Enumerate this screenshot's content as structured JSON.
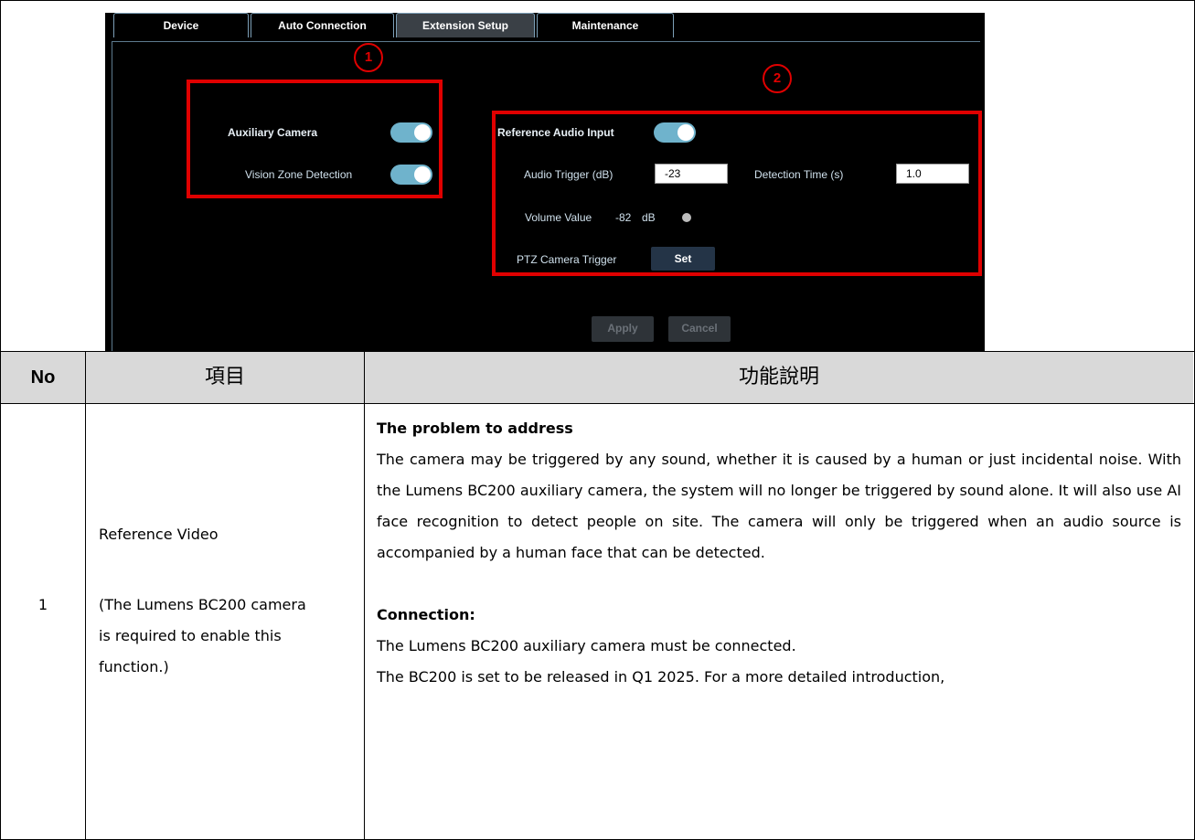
{
  "screenshot": {
    "tabs": [
      "Device",
      "Auto Connection",
      "Extension Setup",
      "Maintenance"
    ],
    "active_tab": "Extension Setup",
    "markers": [
      "1",
      "2"
    ],
    "left_panel": {
      "auxiliary_camera_label": "Auxiliary Camera",
      "auxiliary_camera_on": true,
      "vision_zone_label": "Vision Zone Detection",
      "vision_zone_on": true
    },
    "right_panel": {
      "reference_audio_label": "Reference Audio Input",
      "reference_audio_on": true,
      "audio_trigger_label": "Audio Trigger (dB)",
      "audio_trigger_value": "-23",
      "detection_time_label": "Detection Time (s)",
      "detection_time_value": "1.0",
      "volume_label": "Volume Value",
      "volume_value": "-82",
      "volume_unit": "dB",
      "ptz_label": "PTZ Camera Trigger",
      "set_label": "Set"
    },
    "apply_label": "Apply",
    "cancel_label": "Cancel"
  },
  "table": {
    "headers": [
      "No",
      "項目",
      "功能說明"
    ],
    "row": {
      "no": "1",
      "item_title": "Reference Video",
      "item_note": "(The Lumens BC200 camera is required to enable this function.)",
      "problem_heading": "The problem to address",
      "problem_text": "The camera may be triggered by any sound, whether it is caused by a human or just incidental noise. With the Lumens BC200 auxiliary camera, the system will no longer be triggered by sound alone. It will also use AI face recognition to detect people on site. The camera will only be triggered when an audio source is accompanied by a human face that can be detected.",
      "connection_heading": "Connection:",
      "connection_line1": "The Lumens BC200 auxiliary camera must be connected.",
      "connection_line2": "The BC200 is set to be released in Q1 2025. For a more detailed introduction,"
    }
  },
  "colors": {
    "highlight_red": "#e00000",
    "toggle_on": "#6fb3cc",
    "header_gray": "#d9d9d9"
  }
}
